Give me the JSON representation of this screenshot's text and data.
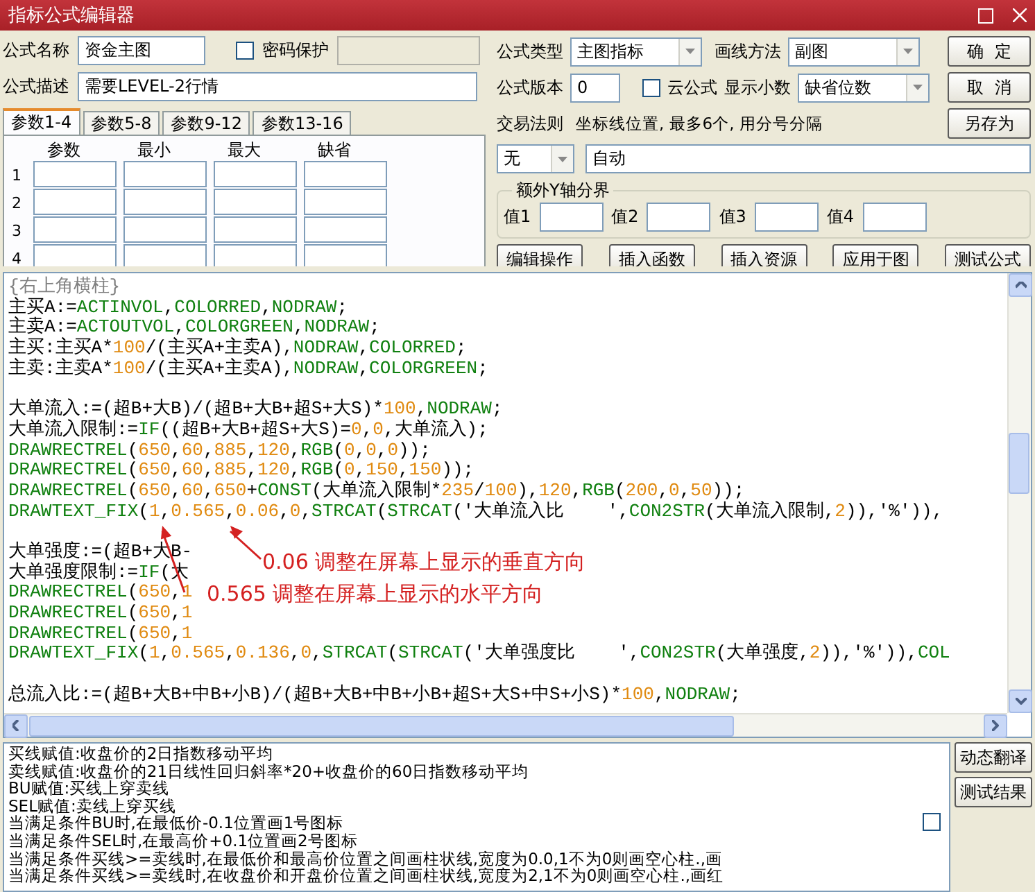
{
  "window": {
    "title": "指标公式编辑器"
  },
  "formula_name": {
    "label": "公式名称",
    "value": "资金主图"
  },
  "password": {
    "label": "密码保护",
    "checked": false
  },
  "description": {
    "label": "公式描述",
    "value": "需要LEVEL-2行情"
  },
  "param_tabs": [
    {
      "label": "参数1-4",
      "selected": true
    },
    {
      "label": "参数5-8",
      "selected": false
    },
    {
      "label": "参数9-12",
      "selected": false
    },
    {
      "label": "参数13-16",
      "selected": false
    }
  ],
  "param_table": {
    "columns": [
      "参数",
      "最小",
      "最大",
      "缺省"
    ],
    "rows": [
      "1",
      "2",
      "3",
      "4"
    ]
  },
  "formula_type": {
    "label": "公式类型",
    "value": "主图指标"
  },
  "draw_method": {
    "label": "画线方法",
    "value": "副图"
  },
  "version": {
    "label": "公式版本",
    "value": "0"
  },
  "cloud": {
    "label": "云公式",
    "checked": false
  },
  "decimals": {
    "label": "显示小数",
    "value": "缺省位数"
  },
  "trade_rule": {
    "label": "交易法则",
    "value": "无"
  },
  "axis_lines": {
    "label": "坐标线位置, 最多6个, 用分号分隔",
    "value": "自动"
  },
  "y_axis_group": {
    "title": "额外Y轴分界",
    "fields": [
      {
        "label": "值1"
      },
      {
        "label": "值2"
      },
      {
        "label": "值3"
      },
      {
        "label": "值4"
      }
    ]
  },
  "side_buttons": [
    "确  定",
    "取  消",
    "另存为"
  ],
  "tool_buttons": [
    "编辑操作",
    "插入函数",
    "插入资源",
    "应用于图",
    "测试公式"
  ],
  "code_lines": [
    {
      "kind": "comment",
      "text": "{右上角横柱}"
    },
    {
      "kind": "code",
      "text": "主买A:=ACTINVOL,COLORRED,NODRAW;"
    },
    {
      "kind": "code",
      "text": "主卖A:=ACTOUTVOL,COLORGREEN,NODRAW;"
    },
    {
      "kind": "code",
      "text": "主买:主买A*100/(主买A+主卖A),NODRAW,COLORRED;"
    },
    {
      "kind": "code",
      "text": "主卖:主卖A*100/(主买A+主卖A),NODRAW,COLORGREEN;"
    },
    {
      "kind": "blank"
    },
    {
      "kind": "code",
      "text": "大单流入:=(超B+大B)/(超B+大B+超S+大S)*100,NODRAW;"
    },
    {
      "kind": "code",
      "text": "大单流入限制:=IF((超B+大B+超S+大S)=0,0,大单流入);"
    },
    {
      "kind": "code",
      "text": "DRAWRECTREL(650,60,885,120,RGB(0,0,0));"
    },
    {
      "kind": "code",
      "text": "DRAWRECTREL(650,60,885,120,RGB(0,150,150));"
    },
    {
      "kind": "code",
      "text": "DRAWRECTREL(650,60,650+CONST(大单流入限制*235/100),120,RGB(200,0,50));"
    },
    {
      "kind": "code",
      "text": "DRAWTEXT_FIX(1,0.565,0.06,0,STRCAT(STRCAT('大单流入比    ',CON2STR(大单流入限制,2)),'%')),"
    },
    {
      "kind": "blank"
    },
    {
      "kind": "code",
      "text": "大单强度:=(超B+大B-"
    },
    {
      "kind": "code",
      "text": "大单强度限制:=IF(大"
    },
    {
      "kind": "code",
      "text": "DRAWRECTREL(650,1"
    },
    {
      "kind": "code",
      "text": "DRAWRECTREL(650,1"
    },
    {
      "kind": "code",
      "text": "DRAWRECTREL(650,1"
    },
    {
      "kind": "code",
      "text": "DRAWTEXT_FIX(1,0.565,0.136,0,STRCAT(STRCAT('大单强度比    ',CON2STR(大单强度,2)),'%')),COL"
    },
    {
      "kind": "blank"
    },
    {
      "kind": "code",
      "text": "总流入比:=(超B+大B+中B+小B)/(超B+大B+中B+小B+超S+大S+中S+小S)*100,NODRAW;"
    }
  ],
  "annotations": [
    {
      "text": "0.06 调整在屏幕上显示的垂直方向"
    },
    {
      "text": "0.565 调整在屏幕上显示的水平方向"
    }
  ],
  "output_lines": [
    "买线赋值:收盘价的2日指数移动平均",
    "卖线赋值:收盘价的21日线性回归斜率*20+收盘价的60日指数移动平均",
    "BU赋值:买线上穿卖线",
    "SEL赋值:卖线上穿买线",
    "当满足条件BU时,在最低价-0.1位置画1号图标",
    "当满足条件SEL时,在最高价+0.1位置画2号图标",
    "当满足条件买线>=卖线时,在最低价和最高价位置之间画柱状线,宽度为0.0,1不为0则画空心柱.,画",
    "当满足条件买线>=卖线时,在收盘价和开盘价位置之间画柱状线,宽度为2,1不为0则画空心柱.,画红"
  ],
  "output_checkbox": {
    "checked": false
  },
  "output_buttons": [
    "动态翻译",
    "测试结果"
  ]
}
